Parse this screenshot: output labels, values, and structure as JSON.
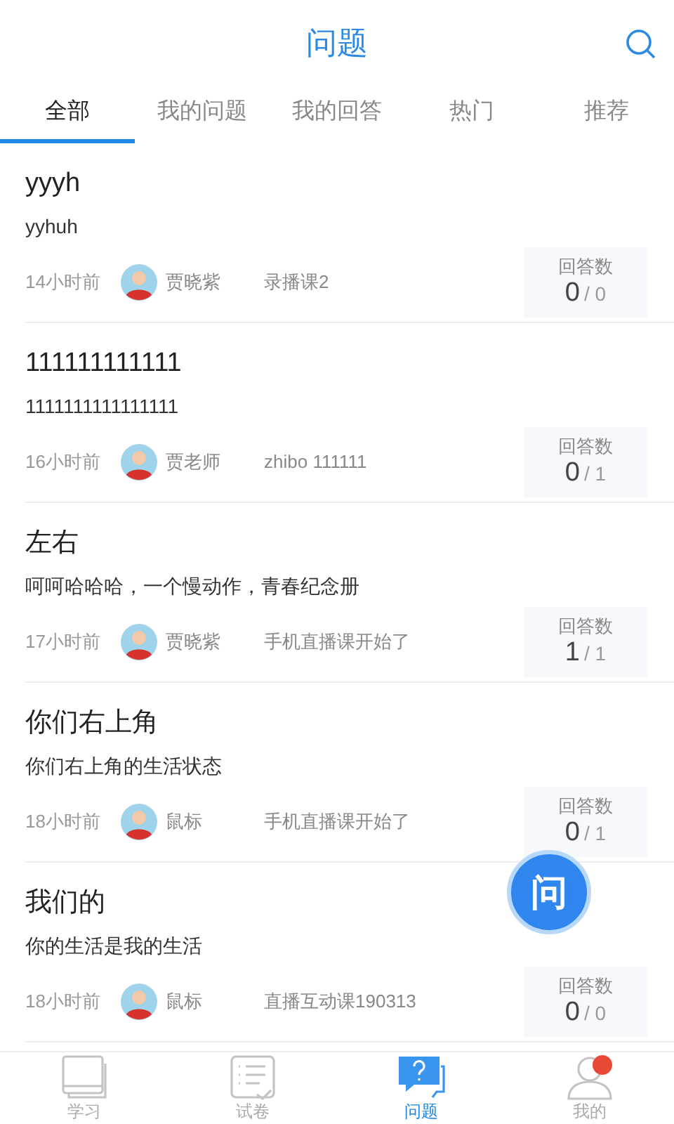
{
  "header": {
    "title": "问题"
  },
  "tabs": [
    {
      "label": "全部",
      "selected": true
    },
    {
      "label": "我的问题",
      "selected": false
    },
    {
      "label": "我的回答",
      "selected": false
    },
    {
      "label": "热门",
      "selected": false
    },
    {
      "label": "推荐",
      "selected": false
    }
  ],
  "questions": [
    {
      "title": "yyyh",
      "body": "yyhuh",
      "time": "14小时前",
      "author": "贾晓紫",
      "course": "录播课2",
      "answers_label": "回答数",
      "answered": "0",
      "total": "/ 0"
    },
    {
      "title": "111111111111",
      "body": "1111111111111111",
      "time": "16小时前",
      "author": "贾老师",
      "course": "zhibo 111111",
      "answers_label": "回答数",
      "answered": "0",
      "total": "/ 1"
    },
    {
      "title": "左右",
      "body": "呵呵哈哈哈，一个慢动作，青春纪念册",
      "time": "17小时前",
      "author": "贾晓紫",
      "course": "手机直播课开始了",
      "answers_label": "回答数",
      "answered": "1",
      "total": "/ 1"
    },
    {
      "title": "你们右上角",
      "body": "你们右上角的生活状态",
      "time": "18小时前",
      "author": "鼠标",
      "course": "手机直播课开始了",
      "answers_label": "回答数",
      "answered": "0",
      "total": "/ 1"
    },
    {
      "title": "我们的",
      "body": "你的生活是我的生活",
      "time": "18小时前",
      "author": "鼠标",
      "course": "直播互动课190313",
      "answers_label": "回答数",
      "answered": "0",
      "total": "/ 0"
    }
  ],
  "ask_button": {
    "label": "问"
  },
  "bottom_nav": [
    {
      "label": "学习",
      "kind": "book",
      "selected": false,
      "badge": false
    },
    {
      "label": "试卷",
      "kind": "paper",
      "selected": false,
      "badge": false
    },
    {
      "label": "问题",
      "kind": "question",
      "selected": true,
      "badge": false
    },
    {
      "label": "我的",
      "kind": "person",
      "selected": false,
      "badge": true
    }
  ]
}
